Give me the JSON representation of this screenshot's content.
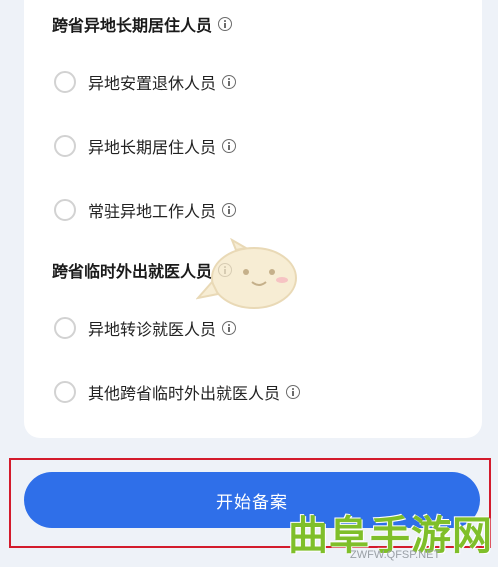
{
  "sections": [
    {
      "title": "跨省异地长期居住人员",
      "options": [
        "异地安置退休人员",
        "异地长期居住人员",
        "常驻异地工作人员"
      ]
    },
    {
      "title": "跨省临时外出就医人员",
      "options": [
        "异地转诊就医人员",
        "其他跨省临时外出就医人员"
      ]
    }
  ],
  "start_button_label": "开始备案",
  "watermark": {
    "logo_text": "曲阜手游网",
    "url": "ZWFW.QFSP.NET"
  },
  "colors": {
    "accent": "#2f6fe9",
    "highlight": "#d31b2c",
    "watermark": "#7fbf2a"
  },
  "icons": {
    "info": "info-circle-icon",
    "radio": "radio-unchecked-icon"
  }
}
